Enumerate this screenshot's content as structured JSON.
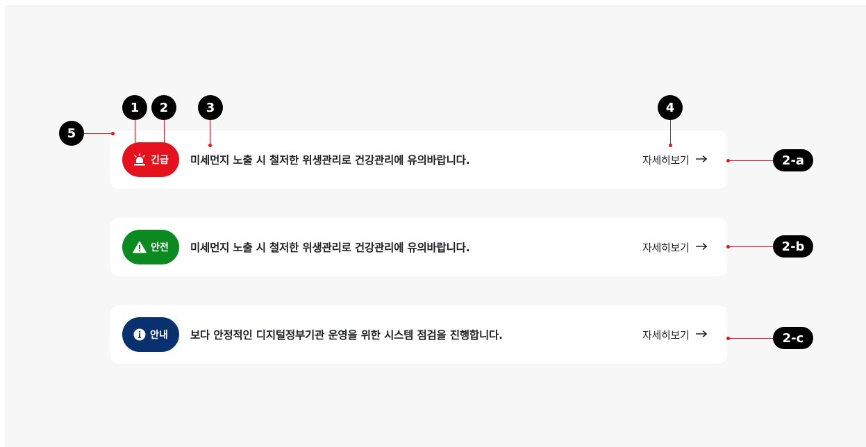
{
  "colors": {
    "urgent": "#e5121e",
    "safe": "#0a8a1f",
    "info": "#09306f",
    "annotation_line": "#e5121e"
  },
  "banners": [
    {
      "badge_label": "긴급",
      "badge_icon": "siren-icon",
      "message": "미세먼지 노출 시 철저한 위생관리로 건강관리에 유의바랍니다.",
      "more_label": "자세히보기",
      "more_icon": "arrow-right-icon"
    },
    {
      "badge_label": "안전",
      "badge_icon": "warning-triangle-icon",
      "message": "미세먼지 노출 시 철저한 위생관리로 건강관리에 유의바랍니다.",
      "more_label": "자세히보기",
      "more_icon": "arrow-right-icon"
    },
    {
      "badge_label": "안내",
      "badge_icon": "info-circle-icon",
      "message": "보다 안정적인 디지털정부기관 운영을 위한 시스템 점검을 진행합니다.",
      "more_label": "자세히보기",
      "more_icon": "arrow-right-icon"
    }
  ],
  "annotations": {
    "marker_1": "1",
    "marker_2": "2",
    "marker_3": "3",
    "marker_4": "4",
    "marker_5": "5",
    "variant_a": "2-a",
    "variant_b": "2-b",
    "variant_c": "2-c"
  }
}
